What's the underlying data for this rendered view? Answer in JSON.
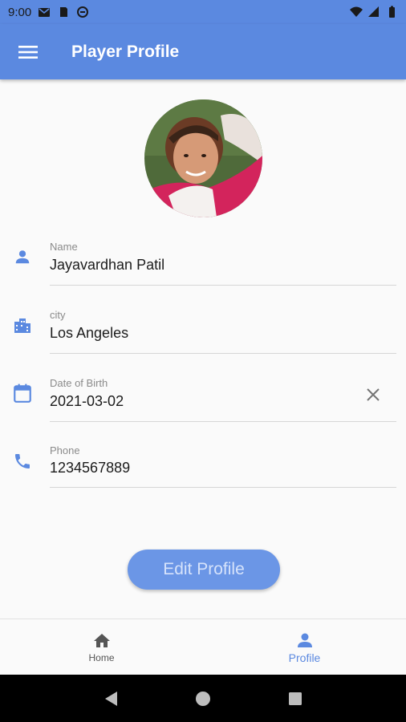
{
  "status_bar": {
    "time": "9:00"
  },
  "app_bar": {
    "title": "Player Profile"
  },
  "profile": {
    "name_label": "Name",
    "name": "Jayavardhan Patil",
    "city_label": "city",
    "city": "Los Angeles",
    "dob_label": "Date of Birth",
    "dob": "2021-03-02",
    "phone_label": "Phone",
    "phone": "1234567889"
  },
  "edit_button": {
    "label": "Edit Profile"
  },
  "bottom_nav": {
    "home_label": "Home",
    "profile_label": "Profile",
    "active": "Profile"
  },
  "colors": {
    "primary": "#5b89e0",
    "button": "#6b96e6",
    "background": "#fafafa"
  },
  "icons": [
    "menu-icon",
    "person-icon",
    "city-icon",
    "calendar-icon",
    "phone-icon",
    "close-icon",
    "home-icon",
    "back-icon",
    "home-circle-icon",
    "recents-icon"
  ]
}
